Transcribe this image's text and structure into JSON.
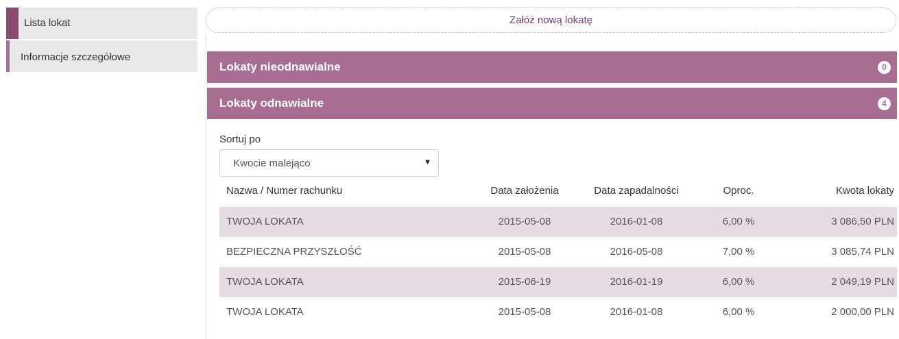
{
  "sidebar": {
    "items": [
      {
        "label": "Lista lokat"
      },
      {
        "label": "Informacje szczegółowe"
      }
    ]
  },
  "main": {
    "new_deposit_label": "Załóż nową lokatę",
    "sections": [
      {
        "title": "Lokaty nieodnawialne",
        "count": "0"
      },
      {
        "title": "Lokaty odnawialne",
        "count": "4"
      }
    ],
    "sort": {
      "label": "Sortuj po",
      "selected": "Kwocie malejąco"
    },
    "table": {
      "headers": [
        "Nazwa / Numer rachunku",
        "Data założenia",
        "Data zapadalności",
        "Oproc.",
        "Kwota lokaty"
      ],
      "rows": [
        [
          "TWOJA LOKATA",
          "2015-05-08",
          "2016-01-08",
          "6,00 %",
          "3 086,50 PLN"
        ],
        [
          "BEZPIECZNA PRZYSZŁOŚĆ",
          "2015-05-08",
          "2016-05-08",
          "7,00 %",
          "3 085,74 PLN"
        ],
        [
          "TWOJA LOKATA",
          "2015-06-19",
          "2016-01-19",
          "6,00 %",
          "2 049,19 PLN"
        ],
        [
          "TWOJA LOKATA",
          "2015-05-08",
          "2016-01-08",
          "6,00 %",
          "2 000,00 PLN"
        ]
      ]
    }
  },
  "colors": {
    "accent": "#a86d92",
    "accent_dark": "#8a4a72",
    "row_alt": "#e7dce3",
    "link": "#7a3a66"
  }
}
